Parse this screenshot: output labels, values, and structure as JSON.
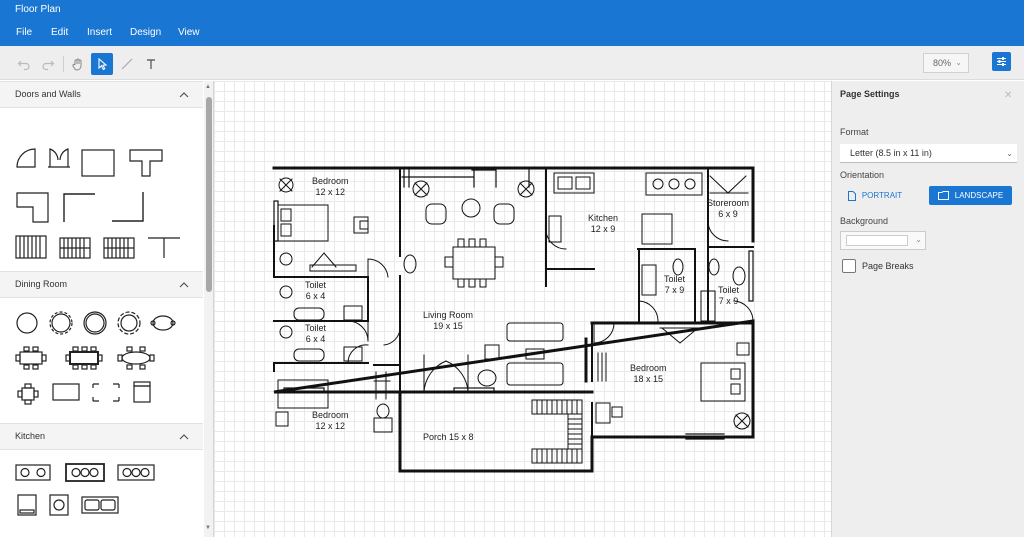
{
  "app": {
    "title": "Floor Plan"
  },
  "menu": [
    "File",
    "Edit",
    "Insert",
    "Design",
    "View"
  ],
  "toolbar": {
    "zoom": "80%"
  },
  "palette": {
    "sections": [
      {
        "title": "Doors and Walls"
      },
      {
        "title": "Dining Room"
      },
      {
        "title": "Kitchen"
      }
    ]
  },
  "floorplan": {
    "rooms": [
      {
        "name": "Bedroom",
        "size": "12 x 12"
      },
      {
        "name": "Toilet",
        "size": "6 x 4"
      },
      {
        "name": "Toilet",
        "size": "6 x 4"
      },
      {
        "name": "Bedroom",
        "size": "12 x 12"
      },
      {
        "name": "Living Room",
        "size": "19 x 15"
      },
      {
        "name": "Kitchen",
        "size": "12 x 9"
      },
      {
        "name": "Storeroom",
        "size": "6 x 9"
      },
      {
        "name": "Toilet",
        "size": "7 x 9"
      },
      {
        "name": "Toilet",
        "size": "7 x 9"
      },
      {
        "name": "Bedroom",
        "size": "18 x 15"
      },
      {
        "name": "Porch 15 x 8",
        "size": ""
      }
    ]
  },
  "page_settings": {
    "title": "Page Settings",
    "format_label": "Format",
    "format_value": "Letter (8.5 in x 11 in)",
    "orientation_label": "Orientation",
    "portrait_label": "PORTRAIT",
    "landscape_label": "LANDSCAPE",
    "background_label": "Background",
    "page_breaks_label": "Page Breaks"
  },
  "colors": {
    "accent": "#1976d2",
    "panel": "#eeeeee",
    "grid": "#e9e9e9"
  }
}
